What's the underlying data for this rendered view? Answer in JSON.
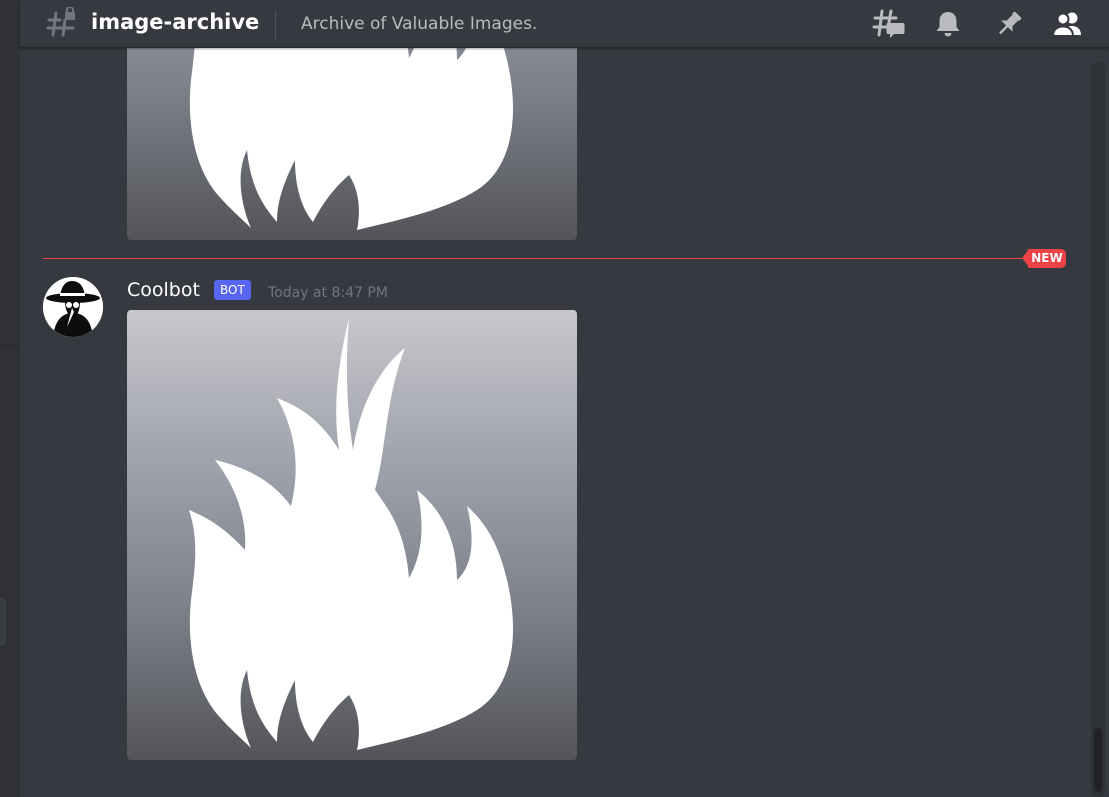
{
  "header": {
    "channel_name": "image-archive",
    "topic": "Archive of Valuable Images.",
    "icons": [
      "locked-channel-icon",
      "threads-icon",
      "bell-icon",
      "pin-icon",
      "member-list-icon"
    ]
  },
  "divider": {
    "label": "NEW",
    "color": "#ed4245"
  },
  "message": {
    "author": "Coolbot",
    "bot_tag": "BOT",
    "timestamp": "Today at 8:47 PM",
    "avatar_icon": "plague-doctor-avatar",
    "attachment_icon": "flame-image"
  },
  "colors": {
    "background": "#36393f",
    "header_text": "#ffffff",
    "topic_text": "#b9bbbe",
    "bot_tag": "#5865f2",
    "timestamp": "#72767d"
  }
}
